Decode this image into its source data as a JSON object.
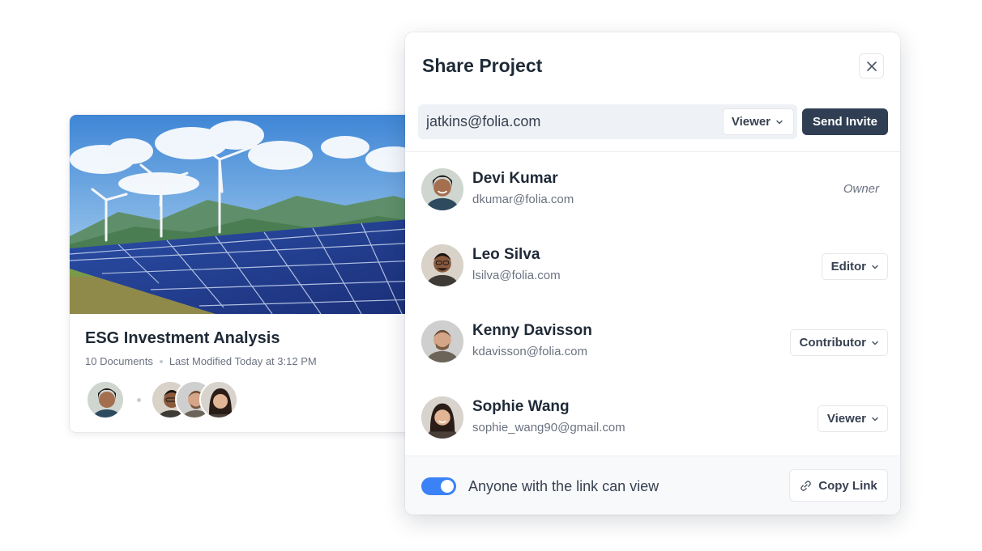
{
  "project_card": {
    "title": "ESG Investment Analysis",
    "documents": "10 Documents",
    "modified": "Last Modified Today at 3:12 PM"
  },
  "dialog": {
    "title": "Share Project",
    "invite_email": "jatkins@folia.com",
    "invite_role": "Viewer",
    "send_label": "Send Invite",
    "members": [
      {
        "name": "Devi Kumar",
        "email": "dkumar@folia.com",
        "role": "Owner"
      },
      {
        "name": "Leo Silva",
        "email": "lsilva@folia.com",
        "role": "Editor"
      },
      {
        "name": "Kenny Davisson",
        "email": "kdavisson@folia.com",
        "role": "Contributor"
      },
      {
        "name": "Sophie Wang",
        "email": "sophie_wang90@gmail.com",
        "role": "Viewer"
      }
    ],
    "link_sharing_label": "Anyone with the link can view",
    "link_sharing_enabled": true,
    "copy_link_label": "Copy Link"
  },
  "colors": {
    "primary_button": "#2f3e52",
    "toggle_on": "#3b82f6"
  }
}
